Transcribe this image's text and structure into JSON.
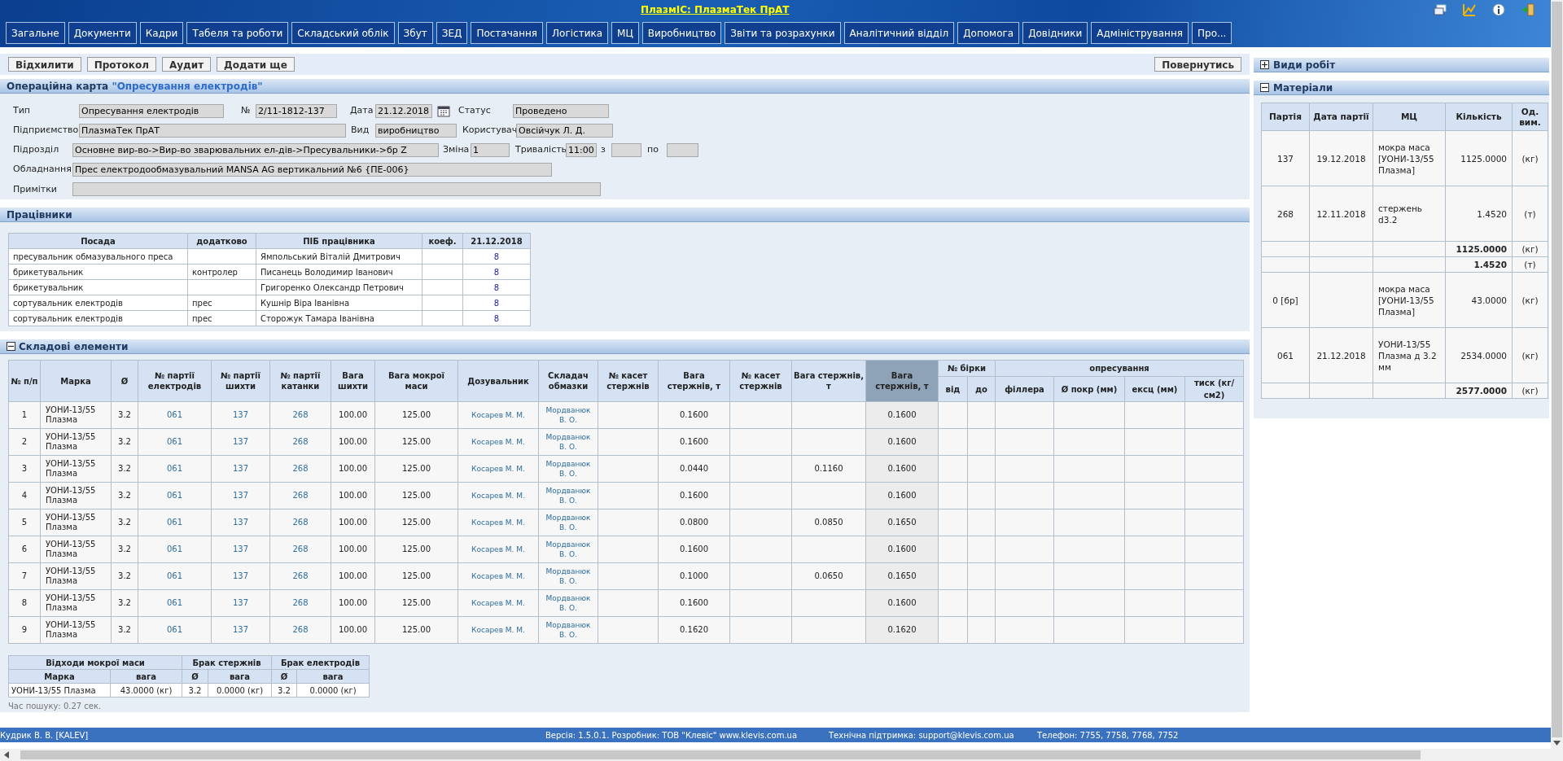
{
  "header": {
    "title": "ПлазмІС: ПлазмаТек ПрАТ",
    "menu": [
      "Загальне",
      "Документи",
      "Кадри",
      "Табеля та роботи",
      "Складський облік",
      "Збут",
      "ЗЕД",
      "Постачання",
      "Логістика",
      "МЦ",
      "Виробництво",
      "Звіти та розрахунки",
      "Аналітичний відділ",
      "Допомога",
      "Довідники",
      "Адміністрування",
      "Про..."
    ]
  },
  "toolbar": {
    "left_buttons": [
      "Відхилити",
      "Протокол",
      "Аудит",
      "Додати ще"
    ],
    "right_button": "Повернутись"
  },
  "operation_card": {
    "heading": "Операційна карта",
    "heading_value": "\"Опресування електродів\"",
    "rows": [
      {
        "fields": [
          {
            "label": "Тип",
            "value": "Опресування електродів",
            "kind": "text"
          },
          {
            "label": "№",
            "value": "2/11-1812-137",
            "kind": "text"
          },
          {
            "label": "Дата",
            "value": "21.12.2018",
            "kind": "date"
          },
          {
            "label": "Статус",
            "value": "Проведено",
            "kind": "text"
          }
        ]
      },
      {
        "fields": [
          {
            "label": "Підприємство",
            "value": "ПлазмаТек ПрАТ",
            "kind": "text"
          },
          {
            "label": "Вид",
            "value": "виробництво",
            "kind": "text"
          },
          {
            "label": "Користувач",
            "value": "Овсійчук Л. Д.",
            "kind": "text"
          }
        ]
      },
      {
        "fields": [
          {
            "label": "Підрозділ",
            "value": "Основне вир-во->Вир-во зварювальних ел-дів->Пресувальники->бр Z",
            "kind": "text"
          },
          {
            "label": "Зміна",
            "value": "1",
            "kind": "text"
          },
          {
            "label": "Тривалість",
            "value": "11:00",
            "kind": "text"
          },
          {
            "label": "з",
            "kind": "text"
          },
          {
            "label": "по",
            "kind": "text"
          }
        ]
      },
      {
        "fields": [
          {
            "label": "Обладнання",
            "value": "Прес електродообмазувальний MANSA AG вертикальний №6 {ПЕ-006}",
            "kind": "text"
          }
        ]
      },
      {
        "fields": [
          {
            "label": "Примітки",
            "kind": "text"
          }
        ]
      }
    ]
  },
  "workers": {
    "title": "Працівники",
    "columns": [
      {
        "label": "Посада",
        "kind": "text"
      },
      {
        "label": "додатково",
        "kind": "text"
      },
      {
        "label": "ПІБ працівника",
        "kind": "text"
      },
      {
        "label": "коеф.",
        "kind": "text"
      },
      {
        "label": "21.12.2018",
        "kind": "link"
      }
    ],
    "rows": [
      [
        "пресувальник обмазувального преса",
        null,
        "Ямпольський Віталій Дмитрович",
        null,
        "8"
      ],
      [
        "брикетувальник",
        "контролер",
        "Писанець Володимир Іванович",
        null,
        "8"
      ],
      [
        "брикетувальник",
        null,
        "Григоренко Олександр Петрович",
        null,
        "8"
      ],
      [
        "сортувальник електродів",
        "прес",
        "Кушнір Віра Іванівна",
        null,
        "8"
      ],
      [
        "сортувальник електродів",
        "прес",
        "Сторожук Тамара Іванівна",
        null,
        "8"
      ]
    ]
  },
  "components": {
    "title": "Складові елементи",
    "expanded": true,
    "columns": [
      {
        "label": "№ п/п",
        "kind": "text",
        "selected": false
      },
      {
        "label": "Марка",
        "kind": "label",
        "selected": false
      },
      {
        "label": "Ø",
        "kind": "text",
        "selected": false
      },
      {
        "label": "№ партії електродів",
        "kind": "link",
        "selected": false
      },
      {
        "label": "№ партії шихти",
        "kind": "link",
        "selected": false
      },
      {
        "label": "№ партії катанки",
        "kind": "link",
        "selected": false
      },
      {
        "label": "Вага шихти",
        "kind": "text",
        "selected": false
      },
      {
        "label": "Вага мокрої маси",
        "kind": "text",
        "selected": false
      },
      {
        "label": "Дозувальник",
        "kind": "name",
        "selected": false
      },
      {
        "label": "Складач обмазки",
        "kind": "name",
        "selected": false
      },
      {
        "label": "№ касет стержнів",
        "kind": "text",
        "selected": false
      },
      {
        "label": "Вага стержнів, т",
        "kind": "text",
        "selected": false
      },
      {
        "label": "№ касет стержнів",
        "kind": "text",
        "selected": false
      },
      {
        "label": "Вага стержнів, т",
        "kind": "text",
        "selected": false
      },
      {
        "label": "Вага стержнів, т",
        "kind": "text",
        "selected": true
      },
      {
        "label": "№ бірки",
        "columns": [
          {
            "label": "від",
            "selected": false
          },
          {
            "label": "до",
            "selected": false
          }
        ]
      },
      {
        "label": "опресування",
        "columns": [
          {
            "label": "філлера",
            "selected": false
          },
          {
            "label": "Ø покр (мм)",
            "selected": false
          },
          {
            "label": "ексц (мм)",
            "selected": false
          },
          {
            "label": "тиск (кг/см2)",
            "selected": false
          }
        ]
      }
    ],
    "rows": [
      [
        "1",
        "УОНИ-13/55 Плазма",
        "3.2",
        "061",
        "137",
        "268",
        "100.00",
        "125.00",
        "Косарев М. М.",
        "Мордванюк В. О.",
        null,
        "0.1600",
        null,
        null,
        "0.1600",
        null,
        null,
        null,
        null,
        null,
        null
      ],
      [
        "2",
        "УОНИ-13/55 Плазма",
        "3.2",
        "061",
        "137",
        "268",
        "100.00",
        "125.00",
        "Косарев М. М.",
        "Мордванюк В. О.",
        null,
        "0.1600",
        null,
        null,
        "0.1600",
        null,
        null,
        null,
        null,
        null,
        null
      ],
      [
        "3",
        "УОНИ-13/55 Плазма",
        "3.2",
        "061",
        "137",
        "268",
        "100.00",
        "125.00",
        "Косарев М. М.",
        "Мордванюк В. О.",
        null,
        "0.0440",
        null,
        "0.1160",
        "0.1600",
        null,
        null,
        null,
        null,
        null,
        null
      ],
      [
        "4",
        "УОНИ-13/55 Плазма",
        "3.2",
        "061",
        "137",
        "268",
        "100.00",
        "125.00",
        "Косарев М. М.",
        "Мордванюк В. О.",
        null,
        "0.1600",
        null,
        null,
        "0.1600",
        null,
        null,
        null,
        null,
        null,
        null
      ],
      [
        "5",
        "УОНИ-13/55 Плазма",
        "3.2",
        "061",
        "137",
        "268",
        "100.00",
        "125.00",
        "Косарев М. М.",
        "Мордванюк В. О.",
        null,
        "0.0800",
        null,
        "0.0850",
        "0.1650",
        null,
        null,
        null,
        null,
        null,
        null
      ],
      [
        "6",
        "УОНИ-13/55 Плазма",
        "3.2",
        "061",
        "137",
        "268",
        "100.00",
        "125.00",
        "Косарев М. М.",
        "Мордванюк В. О.",
        null,
        "0.1600",
        null,
        null,
        "0.1600",
        null,
        null,
        null,
        null,
        null,
        null
      ],
      [
        "7",
        "УОНИ-13/55 Плазма",
        "3.2",
        "061",
        "137",
        "268",
        "100.00",
        "125.00",
        "Косарев М. М.",
        "Мордванюк В. О.",
        null,
        "0.1000",
        null,
        "0.0650",
        "0.1650",
        null,
        null,
        null,
        null,
        null,
        null
      ],
      [
        "8",
        "УОНИ-13/55 Плазма",
        "3.2",
        "061",
        "137",
        "268",
        "100.00",
        "125.00",
        "Косарев М. М.",
        "Мордванюк В. О.",
        null,
        "0.1600",
        null,
        null,
        "0.1600",
        null,
        null,
        null,
        null,
        null,
        null
      ],
      [
        "9",
        "УОНИ-13/55 Плазма",
        "3.2",
        "061",
        "137",
        "268",
        "100.00",
        "125.00",
        "Косарев М. М.",
        "Мордванюк В. О.",
        null,
        "0.1620",
        null,
        null,
        "0.1620",
        null,
        null,
        null,
        null,
        null,
        null
      ]
    ]
  },
  "waste": {
    "groups": [
      {
        "label": "Відходи мокрої маси",
        "columns": [
          "Марка",
          "вага"
        ]
      },
      {
        "label": "Брак стержнів",
        "columns": [
          "Ø",
          "вага"
        ]
      },
      {
        "label": "Брак електродів",
        "columns": [
          "Ø",
          "вага"
        ]
      }
    ],
    "row": [
      "УОНИ-13/55 Плазма",
      "43.0000 (кг)",
      "3.2",
      "0.0000 (кг)",
      "3.2",
      "0.0000 (кг)"
    ]
  },
  "search_time": "Час пошуку: 0.27 сек.",
  "side_sections": [
    {
      "title": "Види робіт",
      "expanded": false
    },
    {
      "title": "Матеріали",
      "expanded": true
    }
  ],
  "materials": {
    "columns": [
      "Партія",
      "Дата партії",
      "МЦ",
      "Кількість",
      "Од. вим."
    ],
    "rows": [
      {
        "kind": "item",
        "cells": [
          "137",
          "19.12.2018",
          "мокра маса [УОНИ-13/55 Плазма]",
          "1125.0000",
          "(кг)"
        ]
      },
      {
        "kind": "item",
        "cells": [
          "268",
          "12.11.2018",
          "стержень d3.2",
          "1.4520",
          "(т)"
        ]
      },
      {
        "kind": "total",
        "cells": [
          null,
          null,
          null,
          "1125.0000",
          "(кг)"
        ]
      },
      {
        "kind": "total",
        "cells": [
          null,
          null,
          null,
          "1.4520",
          "(т)"
        ]
      },
      {
        "kind": "item",
        "cells": [
          "0 [бр]",
          null,
          "мокра маса [УОНИ-13/55 Плазма]",
          "43.0000",
          "(кг)"
        ]
      },
      {
        "kind": "item",
        "cells": [
          "061",
          "21.12.2018",
          "УОНИ-13/55 Плазма д 3.2 мм",
          "2534.0000",
          "(кг)"
        ]
      },
      {
        "kind": "total",
        "cells": [
          null,
          null,
          null,
          "2577.0000",
          "(кг)"
        ]
      }
    ]
  },
  "footer": {
    "user": "Кудрик В. В. [KALEV]",
    "version": "Версія: 1.5.0.1. Розробник: ТОВ \"Клевіс\" www.klevis.com.ua",
    "support": "Технічна підтримка: support@klevis.com.ua",
    "phone": "Телефон: 7755, 7758, 7768, 7752"
  }
}
